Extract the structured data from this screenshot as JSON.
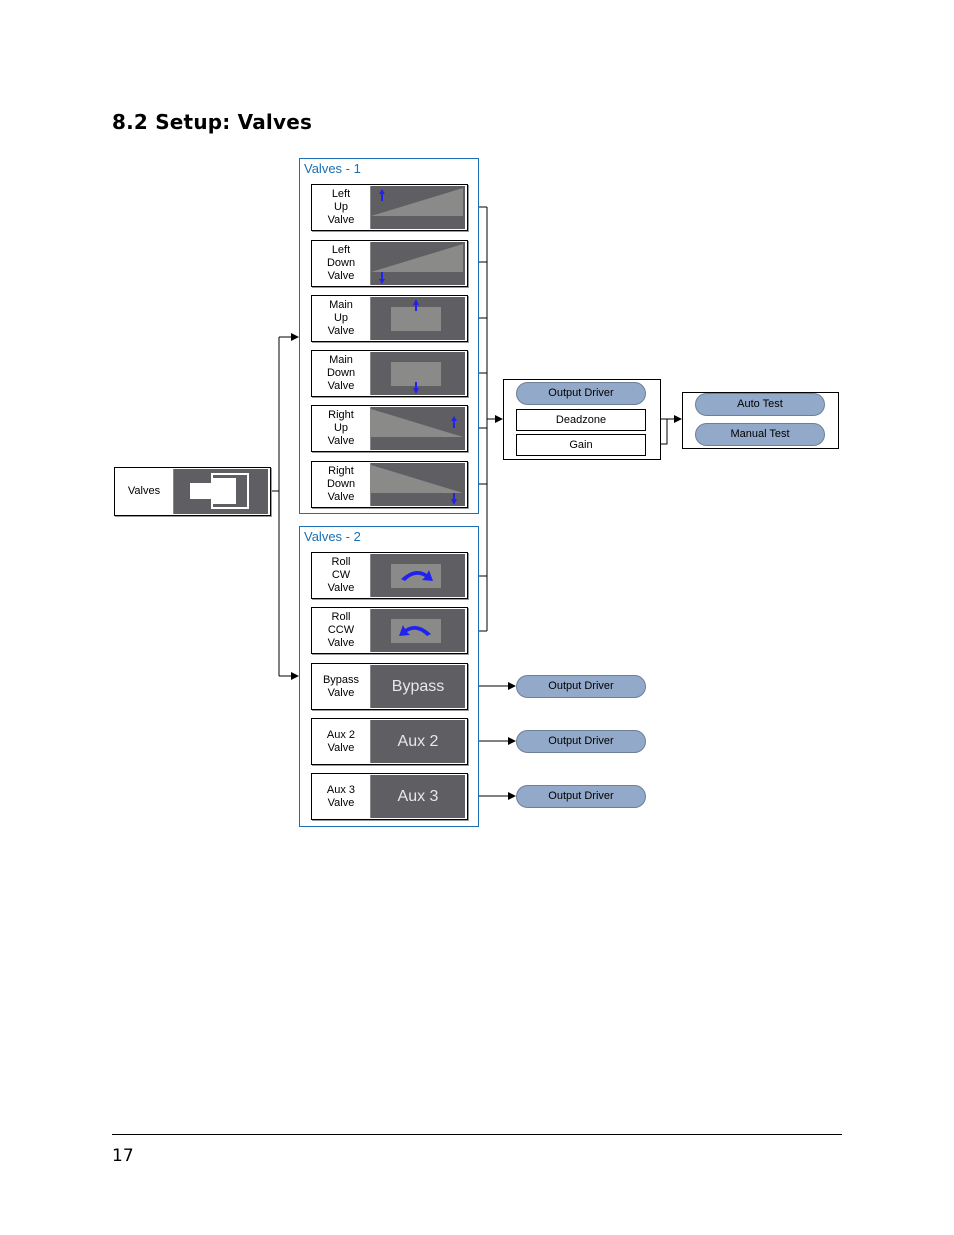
{
  "heading": "8.2  Setup: Valves",
  "root": {
    "label": "Valves",
    "icon": "valve-block-icon"
  },
  "groups": [
    {
      "title": "Valves - 1",
      "items": [
        {
          "label": "Left\nUp\nValve",
          "icon": "left-up-valve-icon"
        },
        {
          "label": "Left\nDown\nValve",
          "icon": "left-down-valve-icon"
        },
        {
          "label": "Main\nUp\nValve",
          "icon": "main-up-valve-icon"
        },
        {
          "label": "Main\nDown\nValve",
          "icon": "main-down-valve-icon"
        },
        {
          "label": "Right\nUp\nValve",
          "icon": "right-up-valve-icon"
        },
        {
          "label": "Right\nDown\nValve",
          "icon": "right-down-valve-icon"
        }
      ]
    },
    {
      "title": "Valves - 2",
      "items": [
        {
          "label": "Roll\nCW\nValve",
          "icon": "roll-cw-icon"
        },
        {
          "label": "Roll\nCCW\nValve",
          "icon": "roll-ccw-icon"
        },
        {
          "label": "Bypass\nValve",
          "thumb_text": "Bypass"
        },
        {
          "label": "Aux 2\nValve",
          "thumb_text": "Aux 2"
        },
        {
          "label": "Aux 3\nValve",
          "thumb_text": "Aux 3"
        }
      ]
    }
  ],
  "driver_panel": {
    "output_driver": "Output Driver",
    "deadzone": "Deadzone",
    "gain": "Gain"
  },
  "test_panel": {
    "auto_test": "Auto Test",
    "manual_test": "Manual Test"
  },
  "single_drivers": [
    "Output Driver",
    "Output Driver",
    "Output Driver"
  ],
  "colors": {
    "group_border": "#1a6fb5",
    "pill_fill": "#93a9c9",
    "thumb_bg": "#5f5e62",
    "arrow_blue": "#2222ee"
  },
  "footer": {
    "page_number": "17"
  }
}
